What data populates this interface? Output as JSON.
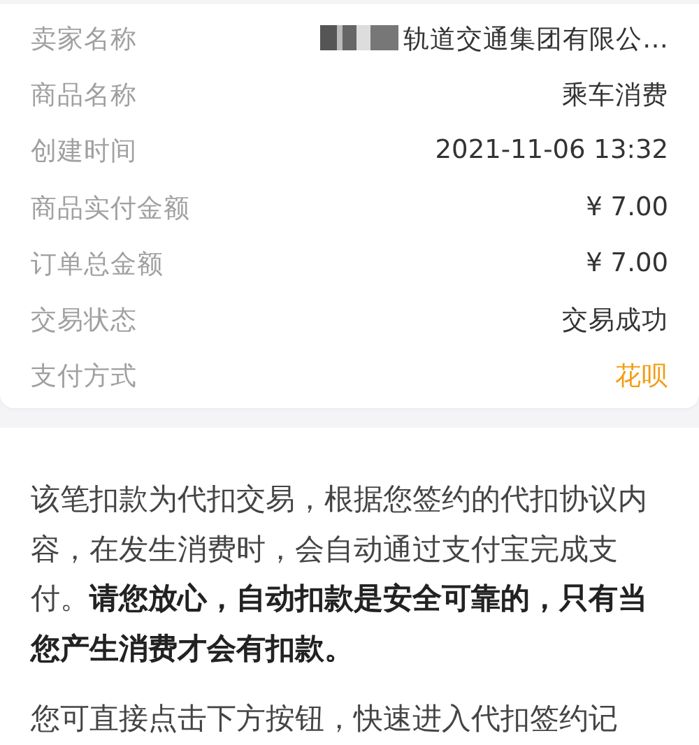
{
  "order_details": [
    {
      "label": "卖家名称",
      "value": "轨道交通集团有限公…",
      "redacted": true,
      "highlight": false
    },
    {
      "label": "商品名称",
      "value": "乘车消费",
      "redacted": false,
      "highlight": false
    },
    {
      "label": "创建时间",
      "value": "2021-11-06 13:32",
      "redacted": false,
      "highlight": false
    },
    {
      "label": "商品实付金额",
      "value": "¥ 7.00",
      "redacted": false,
      "highlight": false
    },
    {
      "label": "订单总金额",
      "value": "¥ 7.00",
      "redacted": false,
      "highlight": false
    },
    {
      "label": "交易状态",
      "value": "交易成功",
      "redacted": false,
      "highlight": false
    },
    {
      "label": "支付方式",
      "value": "花呗",
      "redacted": false,
      "highlight": true
    }
  ],
  "notice": [
    "该笔扣款为代扣交易，根据您签约的代扣协议内容，在发生消费时，会自动通过支付宝完成支付。**请您放心，自动扣款是安全可靠的，只有当您产生消费才会有扣款。**",
    "您可直接点击下方按钮，快速进入代扣签约记"
  ]
}
